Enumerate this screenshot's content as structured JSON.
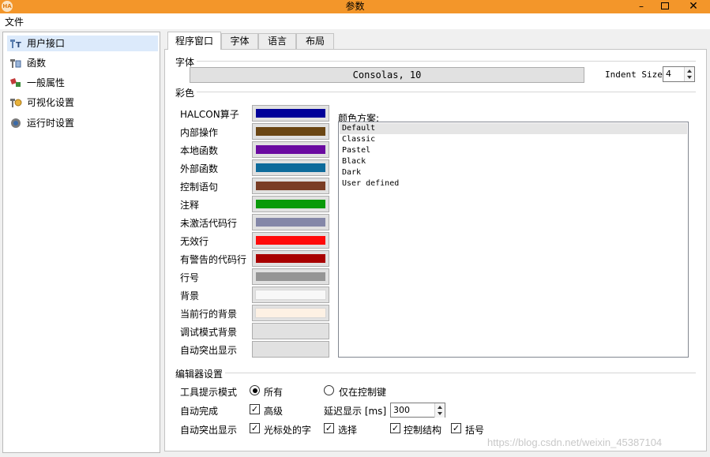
{
  "window": {
    "title": "参数",
    "app_icon_text": "HA",
    "controls": {
      "minimize": "–",
      "close": "✕"
    }
  },
  "menubar": {
    "file": "文件"
  },
  "tree": {
    "items": [
      {
        "label": "用户接口",
        "icon": "ui-tool-icon",
        "selected": true
      },
      {
        "label": "函数",
        "icon": "function-icon",
        "selected": false
      },
      {
        "label": "一般属性",
        "icon": "general-props-icon",
        "selected": false
      },
      {
        "label": "可视化设置",
        "icon": "visualization-icon",
        "selected": false
      },
      {
        "label": "运行时设置",
        "icon": "runtime-icon",
        "selected": false
      }
    ]
  },
  "tabs": [
    {
      "label": "程序窗口",
      "active": true
    },
    {
      "label": "字体",
      "active": false
    },
    {
      "label": "语言",
      "active": false
    },
    {
      "label": "布局",
      "active": false
    }
  ],
  "font_section": {
    "title": "字体",
    "font_button": "Consolas, 10",
    "indent_label": "Indent Size",
    "indent_value": "4"
  },
  "color_section": {
    "title": "彩色",
    "rows": [
      {
        "label": "HALCON算子",
        "color": "#000099"
      },
      {
        "label": "内部操作",
        "color": "#6b4613"
      },
      {
        "label": "本地函数",
        "color": "#6a0aa0"
      },
      {
        "label": "外部函数",
        "color": "#0e6b9b"
      },
      {
        "label": "控制语句",
        "color": "#7a3d25"
      },
      {
        "label": "注释",
        "color": "#0a9a0a"
      },
      {
        "label": "未激活代码行",
        "color": "#8487a8"
      },
      {
        "label": "无效行",
        "color": "#ff0a0a"
      },
      {
        "label": "有警告的代码行",
        "color": "#a80000"
      },
      {
        "label": "行号",
        "color": "#959595"
      },
      {
        "label": "背景",
        "color": "#f8f8f8"
      },
      {
        "label": "当前行的背景",
        "color": "#fdf1e4"
      },
      {
        "label": "调试模式背景",
        "color": null
      },
      {
        "label": "自动突出显示",
        "color": null
      }
    ],
    "scheme_label": "颜色方案:",
    "schemes": [
      "Default",
      "Classic",
      "Pastel",
      "Black",
      "Dark",
      "User defined"
    ],
    "selected_scheme": "Default"
  },
  "editor_section": {
    "title": "编辑器设置",
    "tooltip_mode_label": "工具提示模式",
    "tooltip_all": "所有",
    "tooltip_ctrl": "仅在控制键",
    "tooltip_selected": "all",
    "autocomplete_label": "自动完成",
    "advanced": "高级",
    "advanced_checked": true,
    "delay_label": "延迟显示 [ms]",
    "delay_value": "300",
    "autohighlight_label": "自动突出显示",
    "at_cursor": "光标处的字",
    "at_cursor_checked": true,
    "selection": "选择",
    "selection_checked": true,
    "control_structure": "控制结构",
    "control_structure_checked": true,
    "brackets": "括号",
    "brackets_checked": true
  },
  "watermark": "https://blog.csdn.net/weixin_45387104"
}
